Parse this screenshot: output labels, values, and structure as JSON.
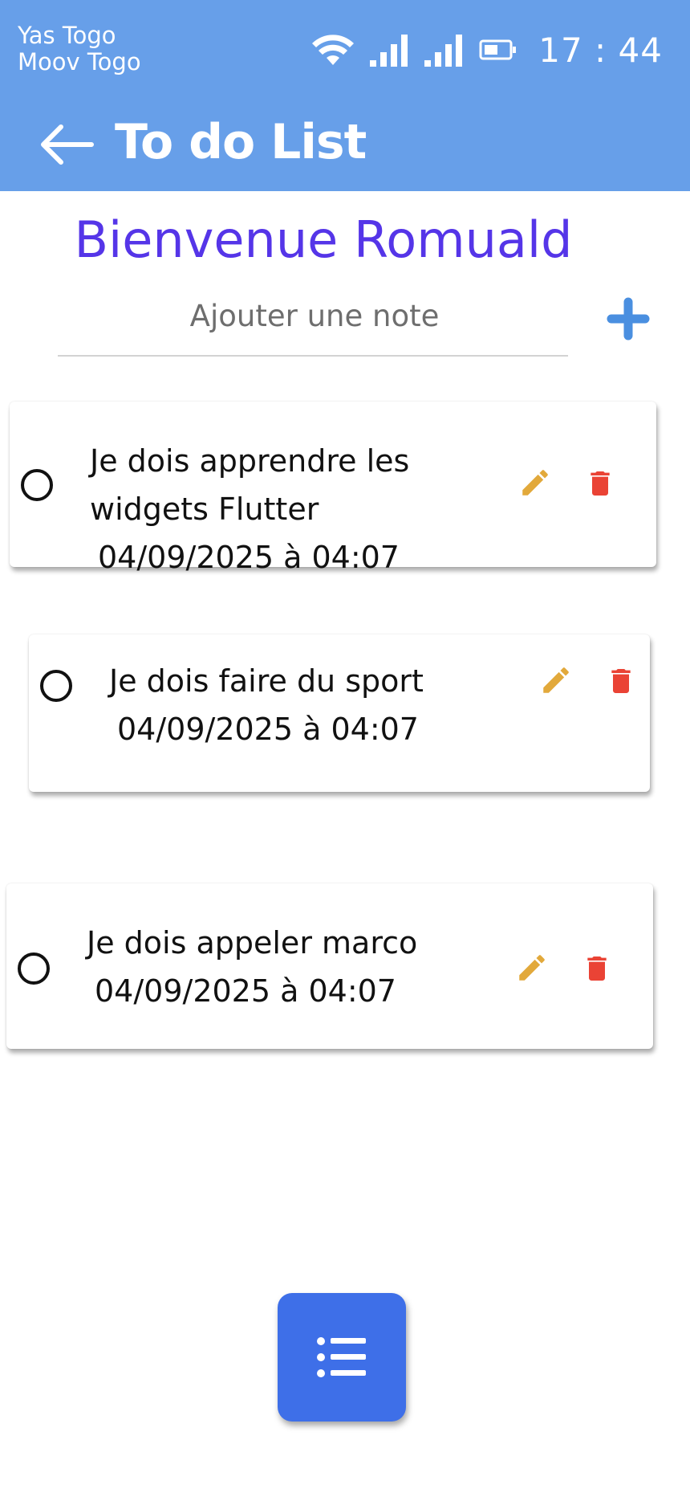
{
  "status_bar": {
    "carrier_1": "Yas Togo",
    "carrier_2": "Moov Togo",
    "time": "17 : 44"
  },
  "app_bar": {
    "title": "To do List"
  },
  "welcome": "Bienvenue Romuald",
  "note_input": {
    "placeholder": "Ajouter une note",
    "value": ""
  },
  "tasks": [
    {
      "line1": "Je dois apprendre les",
      "line2": "widgets Flutter",
      "date": "04/09/2025 à 04:07",
      "done": false
    },
    {
      "line1": "Je dois faire du sport",
      "date": "04/09/2025 à 04:07",
      "done": false
    },
    {
      "line1": "Je dois appeler marco",
      "date": "04/09/2025 à 04:07",
      "done": false
    }
  ],
  "colors": {
    "app_bar": "#679fe9",
    "welcome_text": "#5535e8",
    "edit_icon": "#e2a93b",
    "delete_icon": "#ea4335",
    "add_icon": "#4a8fe0",
    "fab": "#3e6fe8"
  },
  "icons": {
    "back": "arrow-left-icon",
    "add": "plus-icon",
    "edit": "pencil-icon",
    "delete": "trash-icon",
    "fab": "list-icon",
    "wifi": "wifi-icon",
    "signal": "signal-icon",
    "battery": "battery-icon"
  }
}
